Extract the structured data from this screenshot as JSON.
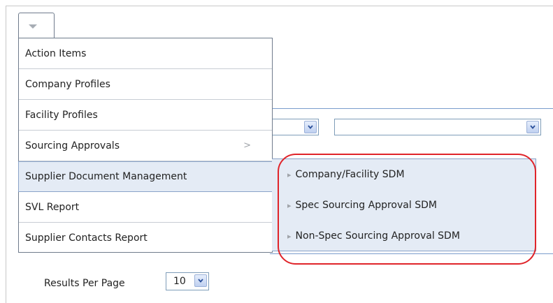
{
  "menu": {
    "items": [
      {
        "label": "Action Items"
      },
      {
        "label": "Company Profiles"
      },
      {
        "label": "Facility Profiles"
      },
      {
        "label": "Sourcing Approvals",
        "has_submenu": true,
        "arrow": ">"
      },
      {
        "label": "Supplier Document Management",
        "active": true
      },
      {
        "label": "SVL Report"
      },
      {
        "label": "Supplier Contacts Report"
      }
    ]
  },
  "submenu": {
    "items": [
      {
        "label": "Company/Facility SDM"
      },
      {
        "label": "Spec Sourcing Approval SDM"
      },
      {
        "label": "Non-Spec Sourcing Approval SDM"
      }
    ],
    "bullet": "▸"
  },
  "form": {
    "select1_value": "",
    "select2_value": "",
    "results_per_page_label": "Results Per Page",
    "results_per_page_value": "10"
  },
  "colors": {
    "active_bg": "#e4ebf5",
    "highlight_ring": "#e0242a",
    "rule": "#7a9ccc"
  }
}
